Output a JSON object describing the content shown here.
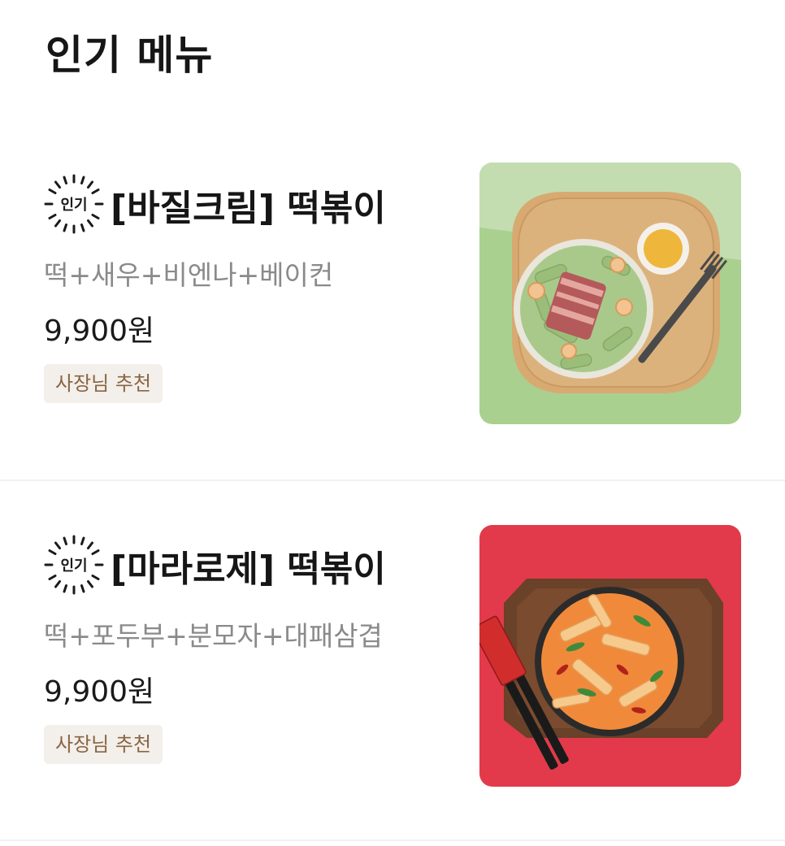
{
  "section": {
    "title": "인기 메뉴"
  },
  "menu_items": [
    {
      "badge": "인기",
      "name": "[바질크림] 떡볶이",
      "description": "떡+새우+비엔나+베이컨",
      "price": "9,900원",
      "tag": "사장님 추천",
      "photo_icon": "basil-cream-tteokbokki-photo",
      "photo_colors": {
        "background_light": "#c3ddb0",
        "background_dark": "#a9d08e",
        "board": "#d8aa72",
        "sauce": "#a9c98a"
      }
    },
    {
      "badge": "인기",
      "name": "[마라로제] 떡볶이",
      "description": "떡+포두부+분모자+대패삼겹",
      "price": "9,900원",
      "tag": "사장님 추천",
      "photo_icon": "mala-rose-tteokbokki-photo",
      "photo_colors": {
        "background": "#e23a4a",
        "tray": "#6a4129",
        "sauce": "#f08a3a"
      }
    }
  ]
}
